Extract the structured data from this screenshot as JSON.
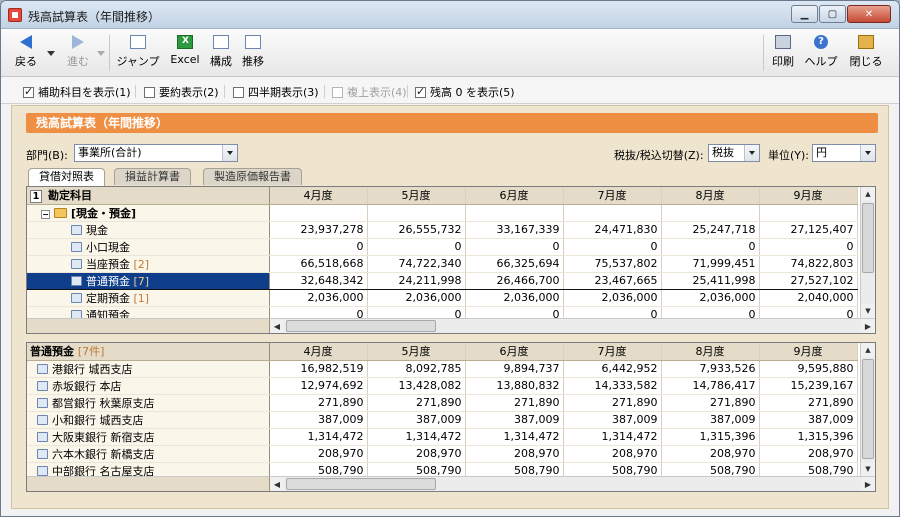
{
  "window": {
    "title": "残高試算表（年間推移）"
  },
  "toolbar": {
    "back": "戻る",
    "forward": "進む",
    "jump": "ジャンプ",
    "excel": "Excel",
    "compose": "構成",
    "trend": "推移",
    "print": "印刷",
    "help": "ヘルプ",
    "close": "閉じる"
  },
  "options": [
    {
      "label": "補助科目を表示(1)",
      "checked": true,
      "enabled": true
    },
    {
      "label": "要約表示(2)",
      "checked": false,
      "enabled": true
    },
    {
      "label": "四半期表示(3)",
      "checked": false,
      "enabled": true
    },
    {
      "label": "複上表示(4)",
      "checked": false,
      "enabled": false
    },
    {
      "label": "残高 0 を表示(5)",
      "checked": true,
      "enabled": true
    }
  ],
  "panel": {
    "header": "残高試算表（年間推移）",
    "dept_label": "部門(B):",
    "dept_value": "事業所(合計)",
    "tax_label": "税抜/税込切替(Z):",
    "tax_value": "税抜",
    "unit_label": "単位(Y):",
    "unit_value": "円"
  },
  "tabs": [
    "貸借対照表",
    "損益計算書",
    "製造原価報告書"
  ],
  "months": [
    "4月度",
    "5月度",
    "6月度",
    "7月度",
    "8月度",
    "9月度"
  ],
  "upper_grid": {
    "row_number": "1",
    "header": "勘定科目",
    "group": "[現金・預金]",
    "rows": [
      {
        "name": "現金",
        "badge": "",
        "values": [
          "23,937,278",
          "26,555,732",
          "33,167,339",
          "24,471,830",
          "25,247,718",
          "27,125,407"
        ]
      },
      {
        "name": "小口現金",
        "badge": "",
        "values": [
          "0",
          "0",
          "0",
          "0",
          "0",
          "0"
        ]
      },
      {
        "name": "当座預金",
        "badge": "[2]",
        "values": [
          "66,518,668",
          "74,722,340",
          "66,325,694",
          "75,537,802",
          "71,999,451",
          "74,822,803"
        ]
      },
      {
        "name": "普通預金",
        "badge": "[7]",
        "values": [
          "32,648,342",
          "24,211,998",
          "26,466,700",
          "23,467,665",
          "25,411,998",
          "27,527,102"
        ],
        "selected": true
      },
      {
        "name": "定期預金",
        "badge": "[1]",
        "values": [
          "2,036,000",
          "2,036,000",
          "2,036,000",
          "2,036,000",
          "2,036,000",
          "2,040,000"
        ]
      },
      {
        "name": "通知預金",
        "badge": "",
        "values": [
          "0",
          "0",
          "0",
          "0",
          "0",
          "0"
        ]
      }
    ]
  },
  "lower_grid": {
    "header": "普通預金",
    "count": "[7件]",
    "rows": [
      {
        "name": "港銀行 城西支店",
        "values": [
          "16,982,519",
          "8,092,785",
          "9,894,737",
          "6,442,952",
          "7,933,526",
          "9,595,880"
        ]
      },
      {
        "name": "赤坂銀行 本店",
        "values": [
          "12,974,692",
          "13,428,082",
          "13,880,832",
          "14,333,582",
          "14,786,417",
          "15,239,167"
        ]
      },
      {
        "name": "都営銀行 秋葉原支店",
        "values": [
          "271,890",
          "271,890",
          "271,890",
          "271,890",
          "271,890",
          "271,890"
        ]
      },
      {
        "name": "小和銀行 城西支店",
        "values": [
          "387,009",
          "387,009",
          "387,009",
          "387,009",
          "387,009",
          "387,009"
        ]
      },
      {
        "name": "大阪東銀行 新宿支店",
        "values": [
          "1,314,472",
          "1,314,472",
          "1,314,472",
          "1,314,472",
          "1,315,396",
          "1,315,396"
        ]
      },
      {
        "name": "六本木銀行 新橋支店",
        "values": [
          "208,970",
          "208,970",
          "208,970",
          "208,970",
          "208,970",
          "208,970"
        ]
      },
      {
        "name": "中部銀行 名古屋支店",
        "values": [
          "508,790",
          "508,790",
          "508,790",
          "508,790",
          "508,790",
          "508,790"
        ]
      }
    ]
  },
  "colors": {
    "accent": "#ef8f43",
    "panel_bg": "#efe5cf",
    "selection": "#0f3f8a"
  }
}
